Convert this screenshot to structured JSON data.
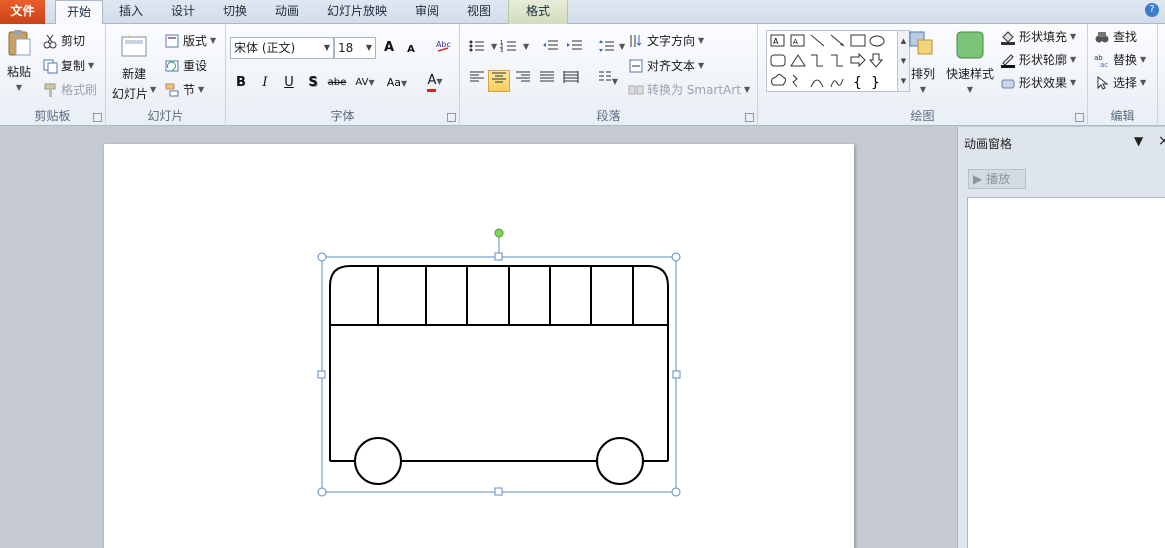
{
  "tabs": [
    {
      "label": "文件"
    },
    {
      "label": "开始"
    },
    {
      "label": "插入"
    },
    {
      "label": "设计"
    },
    {
      "label": "切换"
    },
    {
      "label": "动画"
    },
    {
      "label": "幻灯片放映"
    },
    {
      "label": "审阅"
    },
    {
      "label": "视图"
    },
    {
      "label": "格式"
    }
  ],
  "clipboard": {
    "paste": "粘贴",
    "cut": "剪切",
    "copy": "复制",
    "format_painter": "格式刷",
    "label": "剪贴板"
  },
  "slides": {
    "new_slide_line1": "新建",
    "new_slide_line2": "幻灯片",
    "layout": "版式",
    "reset": "重设",
    "section": "节",
    "label": "幻灯片"
  },
  "font": {
    "name": "宋体 (正文)",
    "size": "18",
    "grow": "A",
    "shrink": "A",
    "bold": "B",
    "italic": "I",
    "underline": "U",
    "shadow": "S",
    "strike": "abe",
    "spacing": "AV",
    "case": "Aa",
    "color": "A",
    "label": "字体"
  },
  "paragraph": {
    "text_direction": "文字方向",
    "align_text": "对齐文本",
    "convert_smartart": "转换为 SmartArt",
    "label": "段落"
  },
  "drawing": {
    "arrange": "排列",
    "quick_styles": "快速样式",
    "shape_fill": "形状填充",
    "shape_outline": "形状轮廓",
    "shape_effects": "形状效果",
    "label": "绘图"
  },
  "editing": {
    "find": "查找",
    "replace": "替换",
    "select": "选择",
    "label": "编辑"
  },
  "animation_pane": {
    "title": "动画窗格",
    "play": "播放"
  },
  "colors": {
    "file_tab": "#d24f1f",
    "selection_handle": "#5a8cc9",
    "rotate_handle": "#7ed957",
    "shape_stroke": "#000000"
  }
}
